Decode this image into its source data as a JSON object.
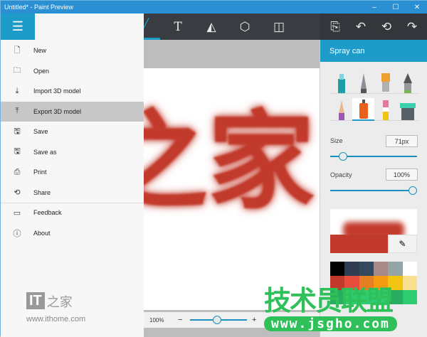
{
  "window": {
    "title": "Untitled* - Paint Preview",
    "minimize": "–",
    "maximize": "☐",
    "close": "✕"
  },
  "toolbar": {
    "menu_icon": "☰",
    "brush_icon": "╱",
    "text_icon": "T",
    "shapes_icon": "◭",
    "3d_icon": "⬡",
    "canvas_icon": "◫",
    "paste_icon": "⎘",
    "undo_icon": "↶",
    "history_icon": "⟲",
    "redo_icon": "↷"
  },
  "menu": {
    "items": [
      {
        "icon": "🗋",
        "label": "New"
      },
      {
        "icon": "🗀",
        "label": "Open"
      },
      {
        "icon": "⤓",
        "label": "Import 3D model"
      },
      {
        "icon": "⤒",
        "label": "Export 3D model",
        "selected": true
      },
      {
        "icon": "🖫",
        "label": "Save"
      },
      {
        "icon": "🖫",
        "label": "Save as"
      },
      {
        "icon": "⎙",
        "label": "Print"
      },
      {
        "icon": "⟲",
        "label": "Share"
      },
      {
        "icon": "▭",
        "label": "Feedback"
      },
      {
        "icon": "ⓘ",
        "label": "About"
      }
    ]
  },
  "logo": {
    "it": "IT",
    "cn": "之家",
    "url": "www.ithome.com"
  },
  "canvas": {
    "art_text": "之家",
    "zoom": "100%",
    "zoom_minus": "−",
    "zoom_plus": "+",
    "zoom_level": 0.5
  },
  "panel": {
    "title": "Spray can",
    "size_label": "Size",
    "size_value": "71px",
    "size_fraction": 0.15,
    "opacity_label": "Opacity",
    "opacity_value": "100%",
    "opacity_fraction": 1.0,
    "current_color": "#c23a2b",
    "eyedropper_icon": "✎",
    "palette": [
      "#000000",
      "#2e3e50",
      "#34495e",
      "#a8898a",
      "#95a5a6",
      "#ffffff",
      "#c0392b",
      "#e74c3c",
      "#e67e22",
      "#f39c12",
      "#f1c40f",
      "#f9e08f",
      "#27ae60",
      "#2ecc71",
      "#2ecc71",
      "#2ecc71",
      "#27ae60",
      "#2ecc71"
    ]
  },
  "watermark": {
    "text": "技术员联盟",
    "url": "www.jsgho.com"
  }
}
